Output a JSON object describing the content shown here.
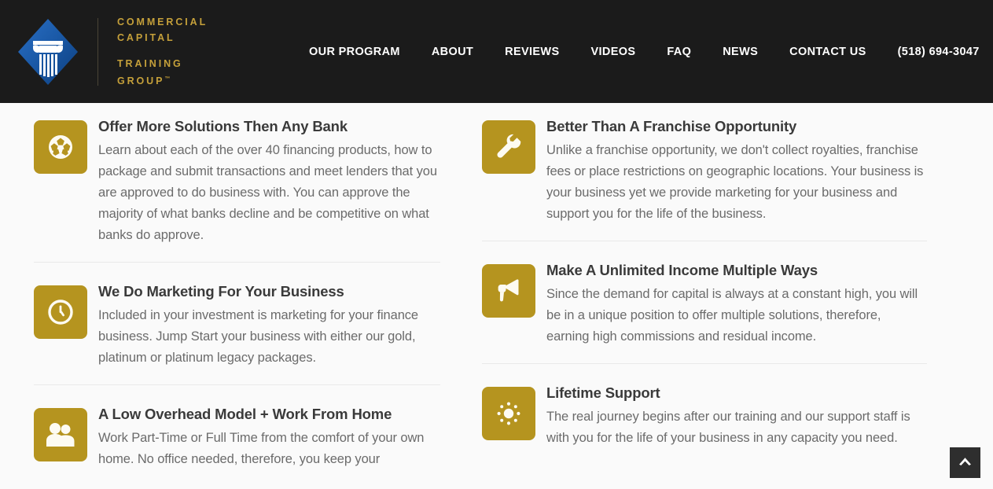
{
  "header": {
    "logo": {
      "icon": "ionic-column-diamond-logo",
      "line_top": "COMMERCIAL",
      "line_top2": "CAPITAL",
      "line_bottom": "TRAINING",
      "line_bottom2": "GROUP",
      "trademark": "™"
    },
    "nav": [
      {
        "label": "OUR PROGRAM",
        "name": "nav-our-program"
      },
      {
        "label": "ABOUT",
        "name": "nav-about"
      },
      {
        "label": "REVIEWS",
        "name": "nav-reviews"
      },
      {
        "label": "VIDEOS",
        "name": "nav-videos"
      },
      {
        "label": "FAQ",
        "name": "nav-faq"
      },
      {
        "label": "NEWS",
        "name": "nav-news"
      },
      {
        "label": "CONTACT US",
        "name": "nav-contact-us"
      },
      {
        "label": "(518) 694-3047",
        "name": "nav-phone"
      }
    ],
    "background_color": "#1b1b1b",
    "logo_text_color": "#c5a03a",
    "nav_text_color": "#ffffff"
  },
  "features": {
    "icon_tile_color": "#b5941f",
    "left_column": [
      {
        "icon": "soccer-ball-icon",
        "title": "Offer More Solutions Then Any Bank",
        "text": "Learn about each of the over 40 financing products, how to package and submit transactions and meet lenders that you are approved to do business with. You can approve the majority of what banks decline and be competitive on what banks do approve."
      },
      {
        "icon": "clock-icon",
        "title": "We Do Marketing For Your Business",
        "text": "Included in your investment is marketing for your finance business. Jump Start your business with either our gold, platinum or platinum legacy packages."
      },
      {
        "icon": "users-icon",
        "title": "A Low Overhead Model + Work From Home",
        "text": "Work Part-Time or Full Time from the comfort of your own home. No office needed, therefore, you keep your"
      }
    ],
    "right_column": [
      {
        "icon": "wrench-icon",
        "title": "Better Than A Franchise Opportunity",
        "text": "Unlike a franchise opportunity, we don't collect royalties, franchise fees or place restrictions on geographic locations. Your business is your business yet we provide marketing for your business and support you for the life of the business."
      },
      {
        "icon": "megaphone-icon",
        "title": "Make A Unlimited Income Multiple Ways",
        "text": "Since the demand for capital is always at a constant high, you will be in a unique position to offer multiple solutions, therefore, earning high commissions and residual income."
      },
      {
        "icon": "sun-icon",
        "title": "Lifetime Support",
        "text": "The real journey begins after our training and our support staff is with you for the life of your business in any capacity you need."
      }
    ]
  },
  "scroll_top": {
    "icon": "chevron-up-icon",
    "background_color": "#2e2e2e"
  }
}
